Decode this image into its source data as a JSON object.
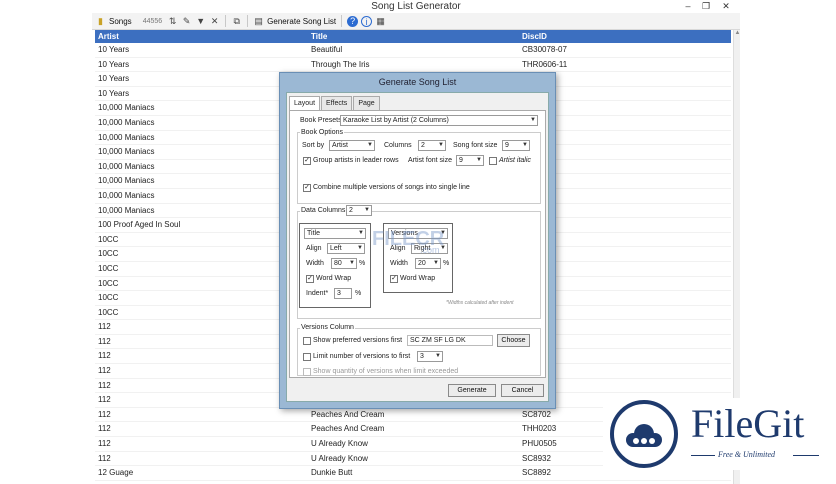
{
  "window": {
    "title": "Song List Generator"
  },
  "toolbar": {
    "songs_label": "Songs",
    "songs_count": "44556",
    "generate_label": "Generate Song List"
  },
  "grid": {
    "columns": [
      "Artist",
      "Title",
      "DiscID"
    ],
    "rows": [
      [
        "10 Years",
        "Beautiful",
        "CB30078-07"
      ],
      [
        "10 Years",
        "Through The Iris",
        "THR0606-11"
      ],
      [
        "10 Years",
        "",
        "3"
      ],
      [
        "10 Years",
        "",
        "-15"
      ],
      [
        "10,000 Maniacs",
        "",
        ""
      ],
      [
        "10,000 Maniacs",
        "",
        ""
      ],
      [
        "10,000 Maniacs",
        "",
        ""
      ],
      [
        "10,000 Maniacs",
        "",
        "07"
      ],
      [
        "10,000 Maniacs",
        "",
        ""
      ],
      [
        "10,000 Maniacs",
        "",
        ""
      ],
      [
        "10,000 Maniacs",
        "",
        ""
      ],
      [
        "10,000 Maniacs",
        "",
        "03"
      ],
      [
        "100 Proof Aged In Soul",
        "",
        ""
      ],
      [
        "10CC",
        "",
        "10"
      ],
      [
        "10CC",
        "",
        ""
      ],
      [
        "10CC",
        "",
        ""
      ],
      [
        "10CC",
        "",
        ""
      ],
      [
        "10CC",
        "",
        "10"
      ],
      [
        "10CC",
        "",
        ""
      ],
      [
        "112",
        "",
        ""
      ],
      [
        "112",
        "",
        "05"
      ],
      [
        "112",
        "",
        ""
      ],
      [
        "112",
        "",
        ""
      ],
      [
        "112",
        "",
        ""
      ],
      [
        "112",
        "",
        ""
      ],
      [
        "112",
        "Peaches And Cream",
        "SC8702"
      ],
      [
        "112",
        "Peaches And Cream",
        "THH0203"
      ],
      [
        "112",
        "U Already Know",
        "PHU0505"
      ],
      [
        "112",
        "U Already Know",
        "SC8932"
      ],
      [
        "12 Guage",
        "Dunkie Butt",
        "SC8892"
      ]
    ]
  },
  "dialog": {
    "title": "Generate Song List",
    "tabs": [
      "Layout",
      "Effects",
      "Page"
    ],
    "book_presets_label": "Book Presets",
    "book_presets_value": "Karaoke List by Artist (2 Columns)",
    "book_options_label": "Book Options",
    "sort_by_label": "Sort by",
    "sort_by_value": "Artist",
    "columns_label": "Columns",
    "columns_value": "2",
    "song_font_size_label": "Song font size",
    "song_font_size_value": "9",
    "group_artists_label": "Group artists in leader rows",
    "artist_font_size_label": "Artist font size",
    "artist_font_size_value": "9",
    "artist_italic_label": "Artist italic",
    "combine_versions_label": "Combine multiple versions of songs into single line",
    "data_columns_label": "Data Columns",
    "data_columns_value": "2",
    "col1": {
      "field": "Title",
      "align_label": "Align",
      "align": "Left",
      "width_label": "Width",
      "width": "80",
      "unit": "%",
      "wrap_label": "Word Wrap",
      "indent_label": "Indent*",
      "indent": "3"
    },
    "col2": {
      "field": "Versions",
      "align_label": "Align",
      "align": "Right",
      "width_label": "Width",
      "width": "20",
      "unit": "%",
      "wrap_label": "Word Wrap"
    },
    "widths_note": "*Widths calculated after indent",
    "versions_column_label": "Versions Column",
    "show_preferred_label": "Show preferred versions first",
    "preferred_value": "SC ZM SF LG DK",
    "choose_label": "Choose",
    "limit_label": "Limit number of versions to first",
    "limit_value": "3",
    "show_quantity_label": "Show quantity of versions when limit exceeded",
    "generate_label": "Generate",
    "cancel_label": "Cancel"
  },
  "watermark": {
    "brand": "FileGit",
    "tagline": "Free & Unlimited",
    "faint_brand": "FILECR",
    "faint_sub": ".com"
  }
}
